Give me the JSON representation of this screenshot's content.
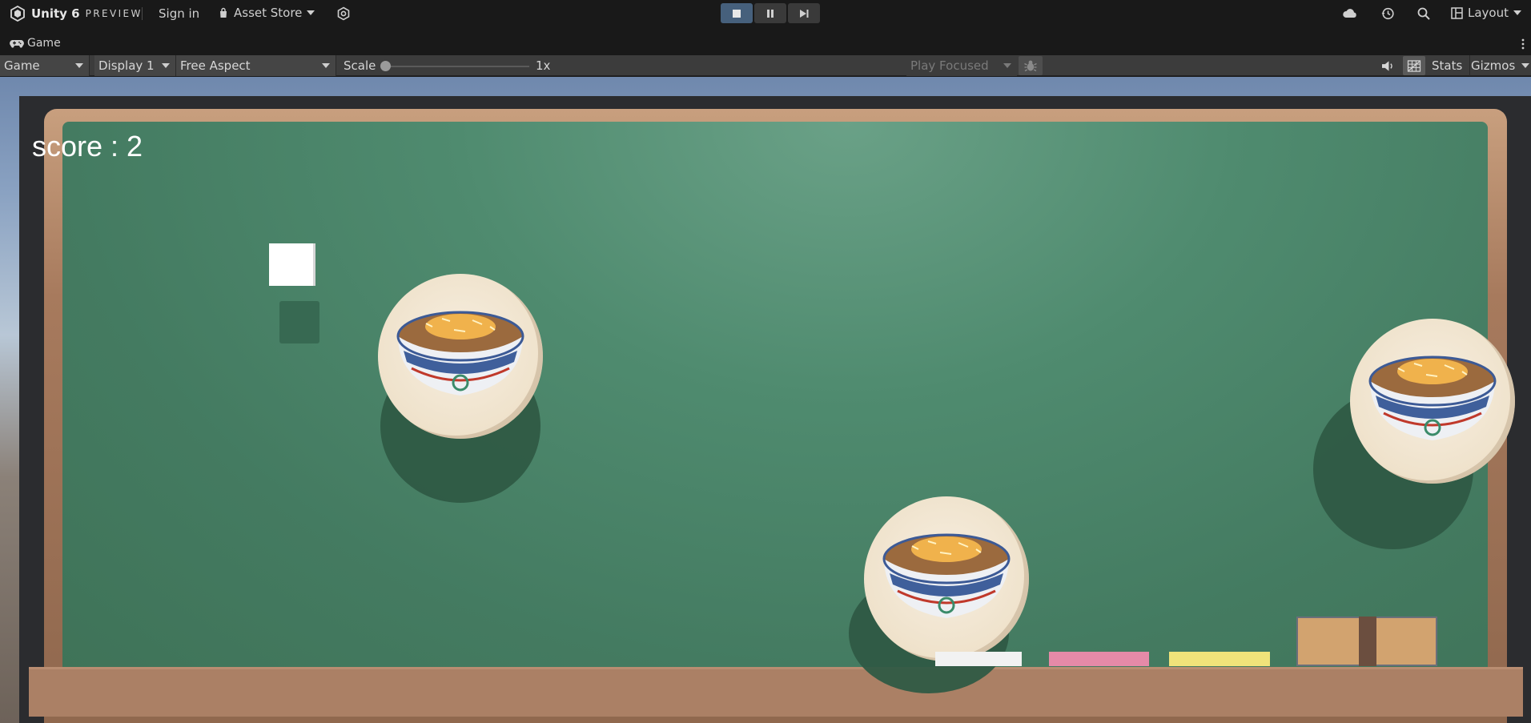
{
  "topbar": {
    "app_name": "Unity 6",
    "edition": "PREVIEW",
    "sign_in": "Sign in",
    "asset_store": "Asset Store",
    "layout": "Layout",
    "icons": [
      "unity-logo-icon",
      "cart-icon",
      "settings-icon",
      "stop-icon",
      "pause-icon",
      "step-icon",
      "cloud-icon",
      "history-icon",
      "search-icon",
      "layout-icon"
    ]
  },
  "tab": {
    "label": "Game"
  },
  "gameview": {
    "view_select": "Game",
    "display": "Display 1",
    "aspect": "Free Aspect",
    "scale_label": "Scale",
    "scale_value": "1x",
    "play_mode": "Play Focused",
    "stats": "Stats",
    "gizmos": "Gizmos"
  },
  "game": {
    "score_text": "score : 2",
    "colors": {
      "board": "#4f8b6f",
      "frame": "#a77a5d",
      "eraser_white": "#f2f2f2",
      "eraser_pink": "#e58aa8",
      "eraser_yellow": "#f0e37a",
      "box": "#d2a36f"
    }
  }
}
